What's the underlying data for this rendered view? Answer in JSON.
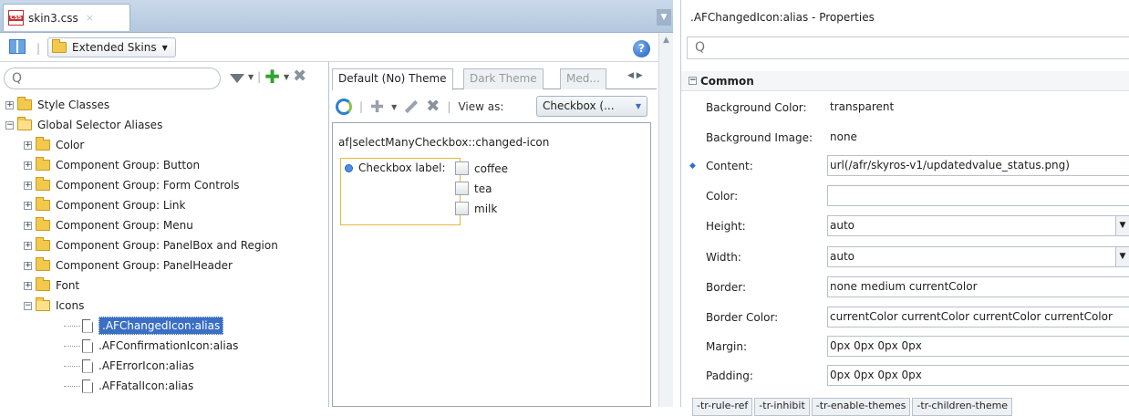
{
  "editor": {
    "file_tab": {
      "name": "skin3.css",
      "close": "×"
    },
    "toolbar": {
      "skins_button": "Extended Skins",
      "help": "?"
    }
  },
  "tree": {
    "search_placeholder": "Q",
    "items": [
      {
        "label": "Style Classes",
        "expander": "+"
      },
      {
        "label": "Global Selector Aliases",
        "expander": "−"
      },
      {
        "label": "Color",
        "expander": "+"
      },
      {
        "label": "Component Group: Button",
        "expander": "+"
      },
      {
        "label": "Component Group: Form Controls",
        "expander": "+"
      },
      {
        "label": "Component Group: Link",
        "expander": "+"
      },
      {
        "label": "Component Group: Menu",
        "expander": "+"
      },
      {
        "label": "Component Group: PanelBox and Region",
        "expander": "+"
      },
      {
        "label": "Component Group: PanelHeader",
        "expander": "+"
      },
      {
        "label": "Font",
        "expander": "+"
      },
      {
        "label": "Icons",
        "expander": "−"
      },
      {
        "label": ".AFChangedIcon:alias"
      },
      {
        "label": ".AFConfirmationIcon:alias"
      },
      {
        "label": ".AFErrorIcon:alias"
      },
      {
        "label": ".AFFatalIcon:alias"
      }
    ]
  },
  "preview": {
    "tabs": [
      "Default (No) Theme",
      "Dark Theme",
      "Med..."
    ],
    "view_as_label": "View as:",
    "view_as_value": "Checkbox (...",
    "selector": "af|selectManyCheckbox::changed-icon",
    "checkbox_label": "Checkbox label:",
    "options": [
      "coffee",
      "tea",
      "milk"
    ]
  },
  "properties": {
    "title": ".AFChangedIcon:alias - Properties",
    "search_placeholder": "Q",
    "section": "Common",
    "rows": [
      {
        "label": "Background Color:",
        "value": "transparent"
      },
      {
        "label": "Background Image:",
        "value": "none"
      },
      {
        "label": "Content:",
        "value": "url(/afr/skyros-v1/updatedvalue_status.png)"
      },
      {
        "label": "Color:",
        "value": ""
      },
      {
        "label": "Height:",
        "value": "auto"
      },
      {
        "label": "Width:",
        "value": "auto"
      },
      {
        "label": "Border:",
        "value": "none medium currentColor"
      },
      {
        "label": "Border Color:",
        "value": "currentColor currentColor currentColor currentColor"
      },
      {
        "label": "Margin:",
        "value": "0px 0px 0px 0px"
      },
      {
        "label": "Padding:",
        "value": "0px 0px 0px 0px"
      }
    ],
    "bottom_tabs": [
      "-tr-rule-ref",
      "-tr-inhibit",
      "-tr-enable-themes",
      "-tr-children-theme"
    ]
  },
  "colors": {
    "selection": "#3a6fc4",
    "accent_blue": "#2c6fd1",
    "folder": "#f2c94c"
  }
}
